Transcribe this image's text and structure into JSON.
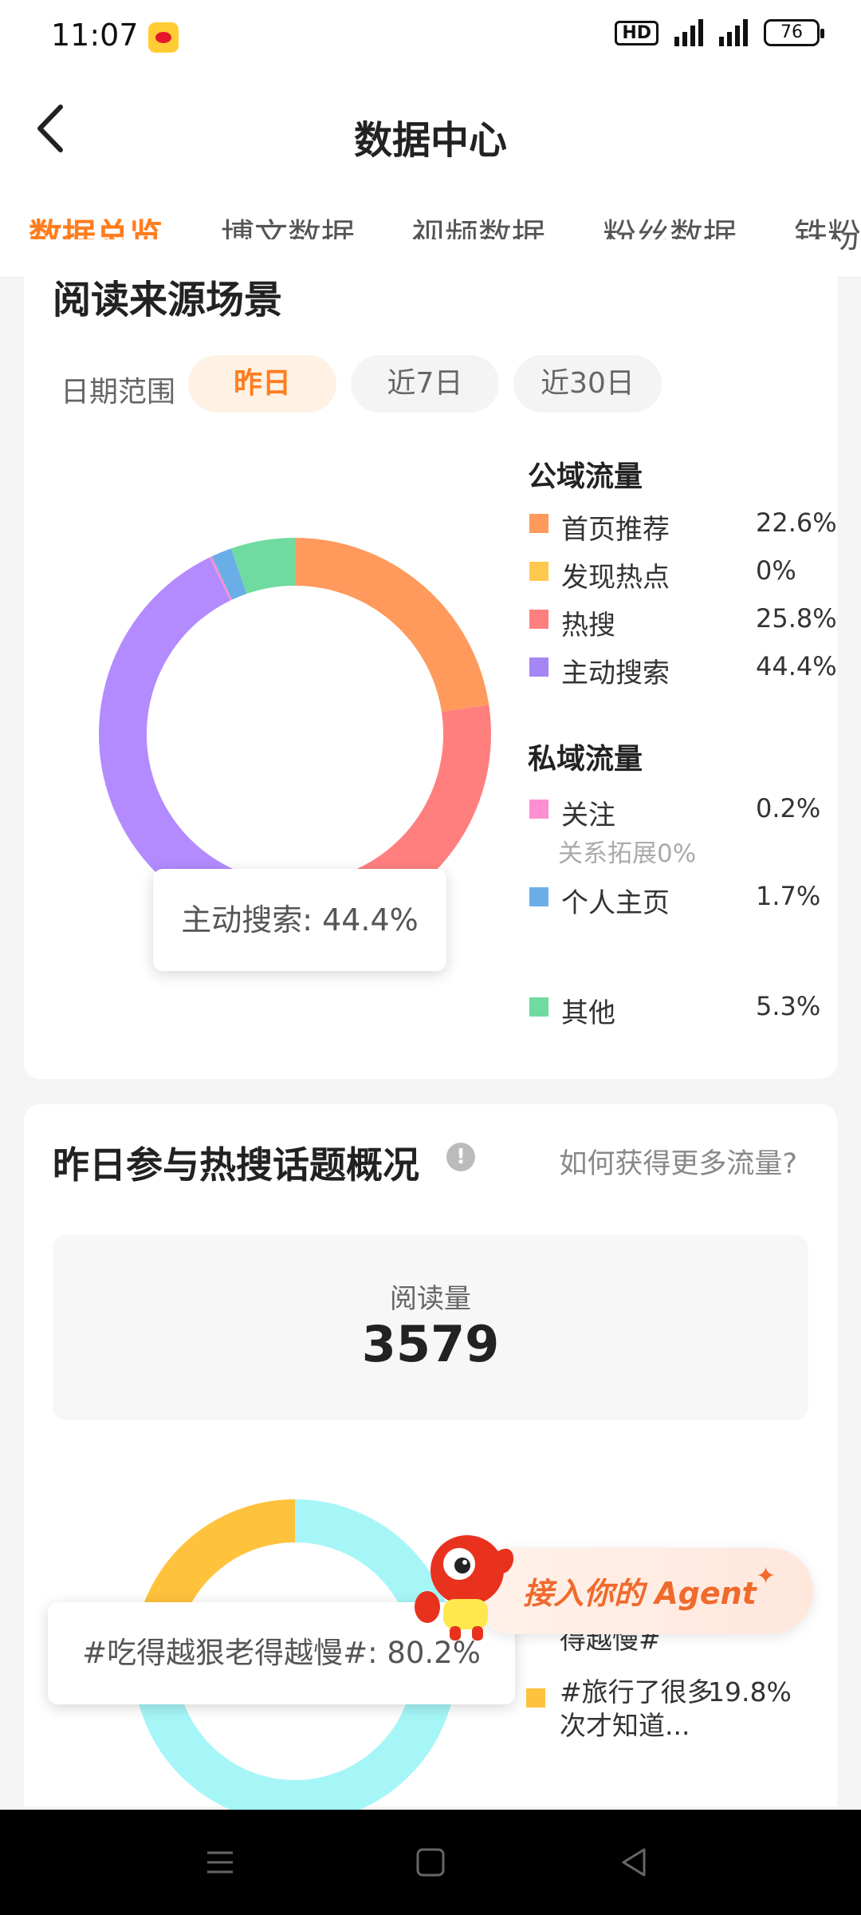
{
  "status_bar": {
    "time": "11:07",
    "network": "HD",
    "battery": "76"
  },
  "header": {
    "title": "数据中心"
  },
  "tabs": [
    {
      "label": "数据总览"
    },
    {
      "label": "博文数据"
    },
    {
      "label": "视频数据"
    },
    {
      "label": "粉丝数据"
    },
    {
      "label": "铁粉"
    }
  ],
  "read_source": {
    "title": "阅读来源场景",
    "date_range_label": "日期范围",
    "range_options": [
      "昨日",
      "近7日",
      "近30日"
    ],
    "tooltip": "主动搜索: 44.4%",
    "public_title": "公域流量",
    "private_title": "私域流量",
    "public_items": [
      {
        "label": "首页推荐",
        "value": "22.6%",
        "color": "#ff9a5c"
      },
      {
        "label": "发现热点",
        "value": "0%",
        "color": "#ffc94d"
      },
      {
        "label": "热搜",
        "value": "25.8%",
        "color": "#ff7f7f"
      },
      {
        "label": "主动搜索",
        "value": "44.4%",
        "color": "#a685f5"
      }
    ],
    "private_items": [
      {
        "label": "关注",
        "value": "0.2%",
        "color": "#ff8fd1"
      },
      {
        "label": "个人主页",
        "value": "1.7%",
        "color": "#6aaee8"
      }
    ],
    "relation_note": "关系拓展0%",
    "other_item": {
      "label": "其他",
      "value": "5.3%",
      "color": "#6fdba0"
    }
  },
  "chart_data": [
    {
      "type": "pie",
      "categories": [
        "首页推荐",
        "发现热点",
        "热搜",
        "主动搜索",
        "关注",
        "个人主页",
        "其他"
      ],
      "values": [
        22.6,
        0,
        25.8,
        44.4,
        0.2,
        1.7,
        5.3
      ],
      "colors": [
        "#ff9a5c",
        "#ffc94d",
        "#ff7f7f",
        "#b38bff",
        "#ff8fd1",
        "#6aaee8",
        "#6fdba0"
      ]
    },
    {
      "type": "pie",
      "categories": [
        "#吃得越狠老得越慢#",
        "#旅行了很多次才知道…"
      ],
      "values": [
        80.2,
        19.8
      ],
      "colors": [
        "#a6f6f8",
        "#ffc23d"
      ]
    }
  ],
  "hot_topics": {
    "title": "昨日参与热搜话题概况",
    "help_link": "如何获得更多流量?",
    "stat_label": "阅读量",
    "stat_value": "3579",
    "tooltip": "#吃得越狠老得越慢#: 80.2%",
    "legend_partial_label": "得越慢#",
    "legend_item": {
      "label": "#旅行了很多次才知道...",
      "value": "19.8%",
      "color": "#ffc23d"
    }
  },
  "agent_banner": {
    "text": "接入你的 Agent"
  }
}
